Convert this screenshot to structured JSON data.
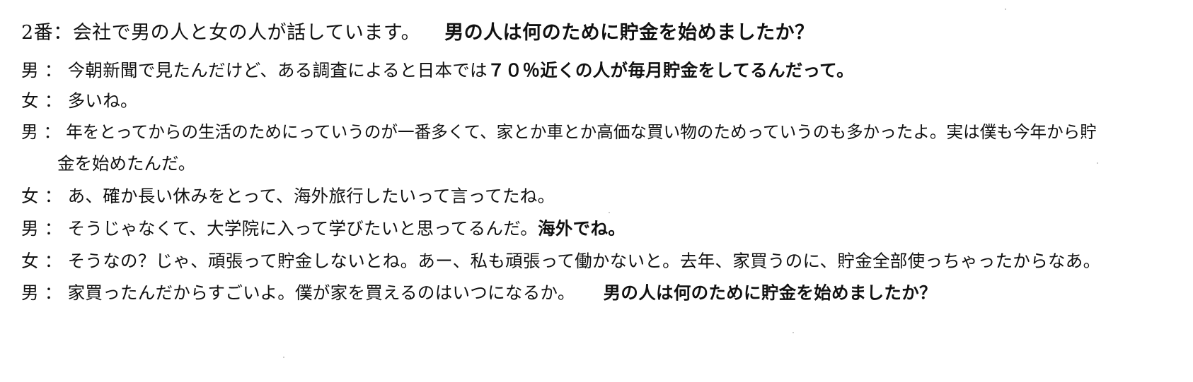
{
  "title": {
    "number": "2番：",
    "situation": "会社で男の人と女の人が話しています。",
    "question": "男の人は何のために貯金を始めましたか？"
  },
  "separator": "：",
  "speakers": {
    "man": "男",
    "woman": "女"
  },
  "lines": [
    {
      "speaker": "男",
      "text": "今朝新聞で見たんだけど、ある調査によると日本では",
      "bold": "７０％近くの人が毎月貯金をしてるんだって。"
    },
    {
      "speaker": "女",
      "text": "多いね。"
    },
    {
      "speaker": "男",
      "text": "年をとってからの生活のためにっていうのが一番多くて、家とか車とか高価な買い物のためっていうのも多かったよ。実は僕も今年から貯",
      "continuation": "金を始めたんだ。"
    },
    {
      "speaker": "女",
      "text": "あ、確か長い休みをとって、海外旅行したいって言ってたね。"
    },
    {
      "speaker": "男",
      "text": "そうじゃなくて、大学院に入って学びたいと思ってるんだ。",
      "bold": "海外でね。"
    },
    {
      "speaker": "女",
      "text": "そうなの？じゃ、頑張って貯金しないとね。あー、私も頑張って働かないと。去年、家買うのに、貯金全部使っちゃったからなあ。"
    },
    {
      "speaker": "男",
      "text": "家買ったんだからすごいよ。僕が家を買えるのはいつになるか。",
      "question": "男の人は何のために貯金を始めましたか？"
    }
  ]
}
